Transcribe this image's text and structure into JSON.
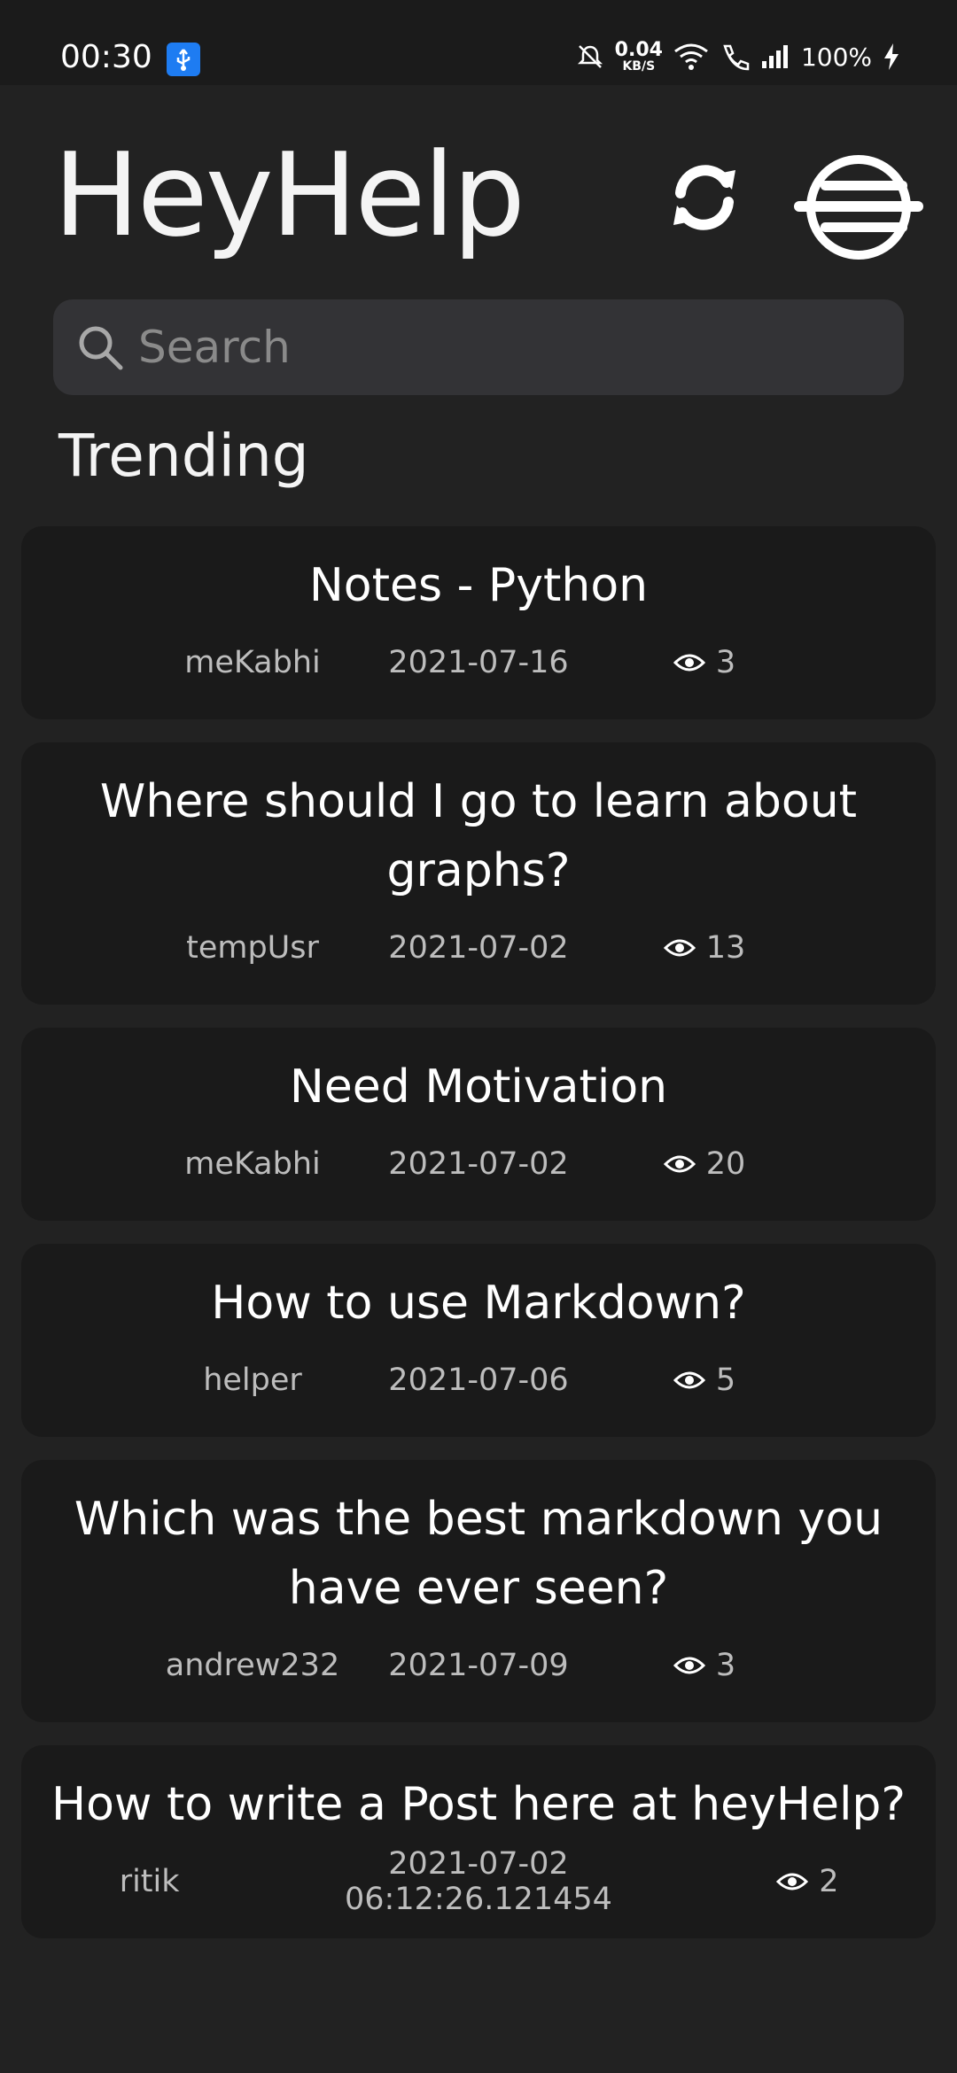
{
  "status_bar": {
    "time": "00:30",
    "net_speed_value": "0.04",
    "net_speed_unit": "KB/S",
    "battery": "100%",
    "icons": [
      "usb-icon",
      "mute-icon",
      "wifi-icon",
      "call-icon",
      "signal-icon",
      "charging-icon"
    ]
  },
  "header": {
    "title": "HeyHelp",
    "refresh_icon": "refresh-icon",
    "menu_icon": "menu-logo-icon"
  },
  "search": {
    "placeholder": "Search",
    "value": ""
  },
  "section": {
    "title": "Trending"
  },
  "posts": [
    {
      "title": "Notes - Python",
      "author": "meKabhi",
      "date": "2021-07-16",
      "views": "3"
    },
    {
      "title": "Where should I go to learn about graphs?",
      "author": "tempUsr",
      "date": "2021-07-02",
      "views": "13"
    },
    {
      "title": "Need Motivation",
      "author": "meKabhi",
      "date": "2021-07-02",
      "views": "20"
    },
    {
      "title": "How to use Markdown?",
      "author": "helper",
      "date": "2021-07-06",
      "views": "5"
    },
    {
      "title": "Which was the best markdown you have ever seen?",
      "author": "andrew232",
      "date": "2021-07-09",
      "views": "3"
    },
    {
      "title": "How to write a Post here at heyHelp?",
      "author": "ritik",
      "date": "2021-07-02 06:12:26.121454",
      "views": "2"
    }
  ],
  "colors": {
    "background": "#222222",
    "card": "#1a1a1a",
    "search": "#333336",
    "usb_badge": "#1e7cf2"
  }
}
